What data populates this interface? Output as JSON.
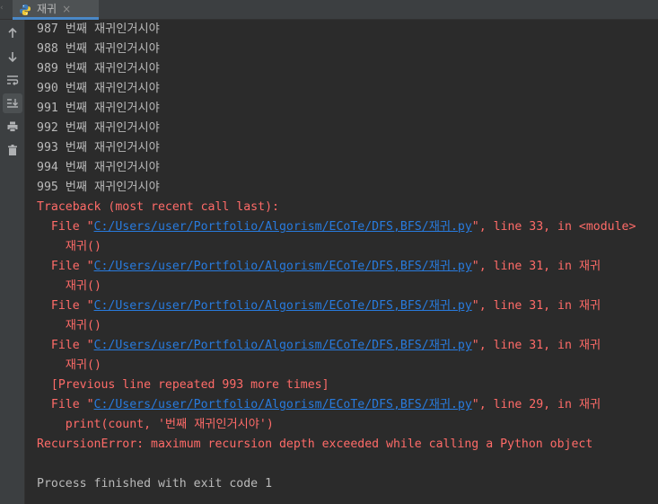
{
  "tab": {
    "title": "재귀",
    "close": "×"
  },
  "toolbar": {
    "up": "arrow-up-icon",
    "down": "arrow-down-icon",
    "wrap": "soft-wrap-icon",
    "scroll_end": "scroll-to-end-icon",
    "print": "print-icon",
    "trash": "trash-icon"
  },
  "output_lines": [
    "987 번째 재귀인거시야",
    "988 번째 재귀인거시야",
    "989 번째 재귀인거시야",
    "990 번째 재귀인거시야",
    "991 번째 재귀인거시야",
    "992 번째 재귀인거시야",
    "993 번째 재귀인거시야",
    "994 번째 재귀인거시야",
    "995 번째 재귀인거시야"
  ],
  "traceback": {
    "header": "Traceback (most recent call last):",
    "file_prefix": "  File \"",
    "path": "C:/Users/user/Portfolio/Algorism/ECoTe/DFS,BFS/재귀.py",
    "frames": [
      {
        "suffix": "\", line 33, in <module>",
        "code": "    재귀()"
      },
      {
        "suffix": "\", line 31, in 재귀",
        "code": "    재귀()"
      },
      {
        "suffix": "\", line 31, in 재귀",
        "code": "    재귀()"
      },
      {
        "suffix": "\", line 31, in 재귀",
        "code": "    재귀()"
      }
    ],
    "repeated": "  [Previous line repeated 993 more times]",
    "last_frame": {
      "suffix": "\", line 29, in 재귀",
      "code": "    print(count, '번째 재귀인거시야')"
    },
    "error": "RecursionError: maximum recursion depth exceeded while calling a Python object"
  },
  "exit_message": "Process finished with exit code 1",
  "colors": {
    "background": "#2b2b2b",
    "stdout": "#bababa",
    "stderr": "#ff6b68",
    "link": "#287bde"
  }
}
